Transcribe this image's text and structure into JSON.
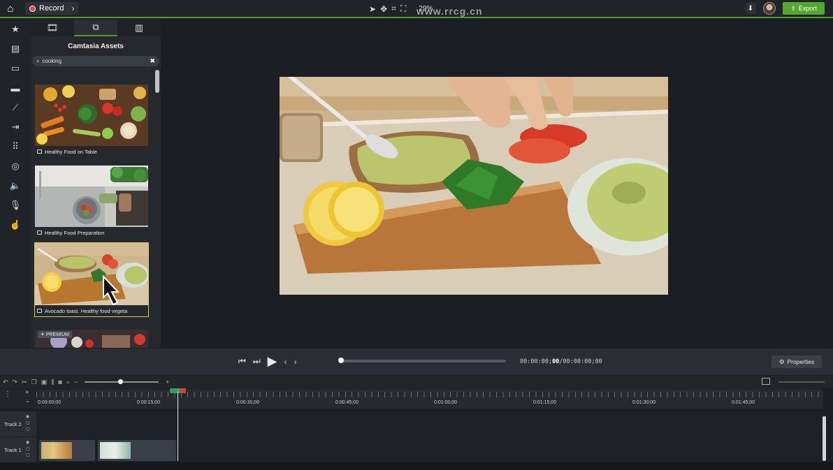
{
  "topbar": {
    "record_label": "Record",
    "zoom": "29%",
    "export_label": "Export",
    "watermark": "www.rrcg.cn"
  },
  "rail": {
    "items": [
      "star-icon",
      "media-icon",
      "annotations-icon",
      "transitions-icon",
      "behaviors-icon",
      "animations-icon",
      "cursor-effects-icon",
      "visual-effects-icon",
      "audio-effects-icon",
      "voice-narration-icon",
      "interactivity-icon"
    ]
  },
  "panel": {
    "title": "Camtasia Assets",
    "search_value": "cooking",
    "assets": [
      {
        "label": "Healthy Food on Table",
        "type": "image"
      },
      {
        "label": "Healthy Food Preparation",
        "type": "video"
      },
      {
        "label": "Avocado toast. Healthy food vegeta",
        "type": "video"
      },
      {
        "label": "",
        "type": "video",
        "badge": "PREMIUM"
      }
    ]
  },
  "playback": {
    "timecode_current": "00:00:00;",
    "timecode_frame": "00",
    "timecode_total": "/00:00:00;00",
    "properties_label": "Properties"
  },
  "timeline": {
    "ruler_labels": [
      "0:00:00;00",
      "0:00:15;00",
      "0:00:30;00",
      "0:00:45;00",
      "0:01:00;00",
      "0:01:15;00",
      "0:01:30;00",
      "0:01:45;00"
    ],
    "tracks": [
      {
        "name": "Track 2"
      },
      {
        "name": "Track 1"
      }
    ]
  },
  "colors": {
    "accent_green": "#4f9b2d",
    "export_green": "#56a832",
    "record_red": "#e2463c",
    "selection_yellow": "#d9c95f"
  }
}
